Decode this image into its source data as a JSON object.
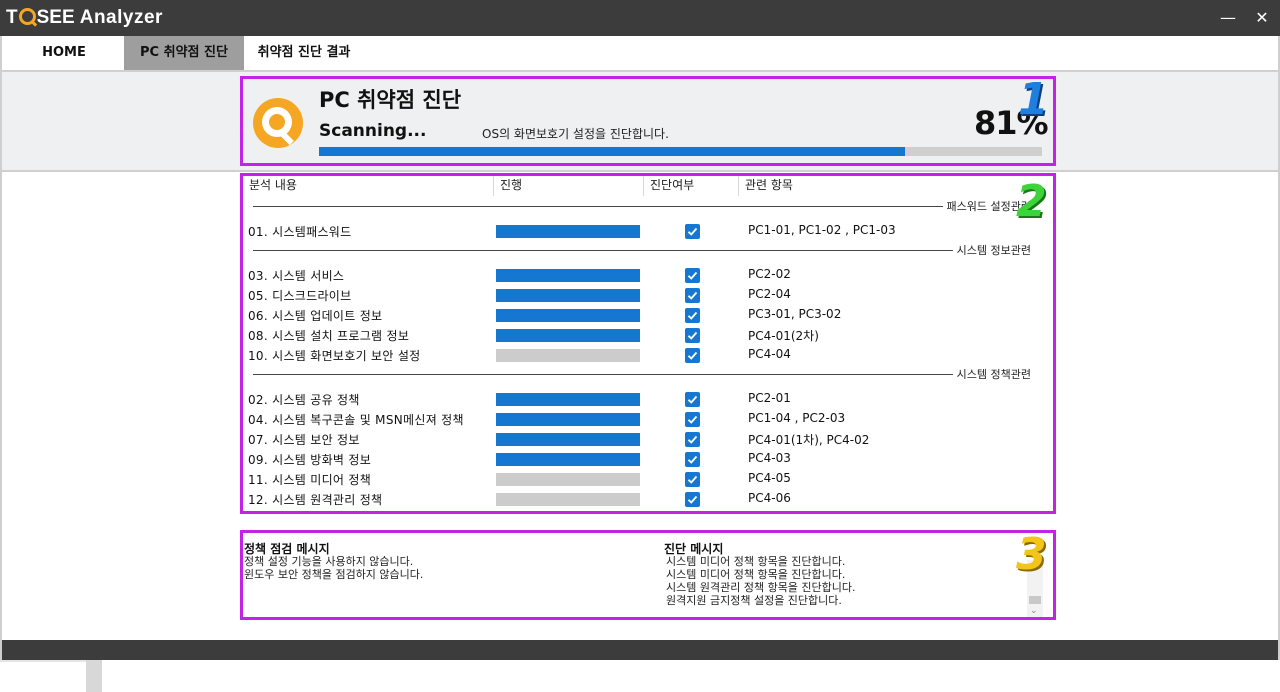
{
  "window": {
    "title_prefix": "T",
    "title_suffix": "SEE",
    "title_app": "Analyzer",
    "minimize_glyph": "—",
    "close_glyph": "✕"
  },
  "menu": {
    "home": "HOME",
    "scan": "PC 취약점 진단",
    "result": "취약점 진단 결과",
    "active": "PC 취약점 진단"
  },
  "scan": {
    "heading": "PC 취약점 진단",
    "status": "Scanning...",
    "message": "OS의 화면보호기 설정을 진단합니다.",
    "percent_label": "81%",
    "percent": 81
  },
  "badges": {
    "one": "1",
    "two": "2",
    "three": "3"
  },
  "table": {
    "headers": {
      "item": "분석 내용",
      "progress": "진행",
      "done": "진단여부",
      "related": "관련 항목"
    },
    "groups": [
      {
        "label": "패스워드 설정관련"
      },
      {
        "label": "시스템 정보관련"
      },
      {
        "label": "시스템 정책관련"
      }
    ],
    "rows": [
      {
        "name": "01. 시스템패스워드",
        "complete": true,
        "checked": true,
        "related": "PC1-01, PC1-02 , PC1-03"
      },
      {
        "name": "03. 시스템 서비스",
        "complete": true,
        "checked": true,
        "related": "PC2-02"
      },
      {
        "name": "05. 디스크드라이브",
        "complete": true,
        "checked": true,
        "related": "PC2-04"
      },
      {
        "name": "06. 시스템 업데이트 정보",
        "complete": true,
        "checked": true,
        "related": "PC3-01, PC3-02"
      },
      {
        "name": "08. 시스템 설치 프로그램 정보",
        "complete": true,
        "checked": true,
        "related": "PC4-01(2차)"
      },
      {
        "name": "10. 시스템 화면보호기 보안 설정",
        "complete": false,
        "checked": true,
        "related": "PC4-04"
      },
      {
        "name": "02. 시스템 공유 정책",
        "complete": true,
        "checked": true,
        "related": "PC2-01"
      },
      {
        "name": "04. 시스템 복구콘솔 및 MSN메신져 정책",
        "complete": true,
        "checked": true,
        "related": "PC1-04 , PC2-03"
      },
      {
        "name": "07. 시스템 보안 정보",
        "complete": true,
        "checked": true,
        "related": "PC4-01(1차), PC4-02"
      },
      {
        "name": "09. 시스템 방화벽 정보",
        "complete": true,
        "checked": true,
        "related": "PC4-03"
      },
      {
        "name": "11. 시스템 미디어 정책",
        "complete": false,
        "checked": true,
        "related": "PC4-05"
      },
      {
        "name": "12. 시스템 원격관리 정책",
        "complete": false,
        "checked": true,
        "related": "PC4-06"
      }
    ]
  },
  "messages": {
    "policy_title": "정책 점검 메시지",
    "policy_lines": [
      "정책 설정 기능을 사용하지 않습니다.",
      "윈도우 보안 정책을 점검하지 않습니다."
    ],
    "diag_title": "진단 메시지",
    "diag_lines": [
      "시스템 미디어 정책 항목을 진단합니다.",
      "시스템 미디어 정책 항목을 진단합니다.",
      "시스템 원격관리 정책 항목을 진단합니다.",
      "원격지원 금지정책 설정을 진단합니다."
    ],
    "scroll_down_glyph": "⌄"
  },
  "colors": {
    "accent": "#1677d2",
    "highlight_frame": "#c223e6",
    "logo_orange": "#f5a623",
    "titlebar": "#3c3c3c"
  }
}
